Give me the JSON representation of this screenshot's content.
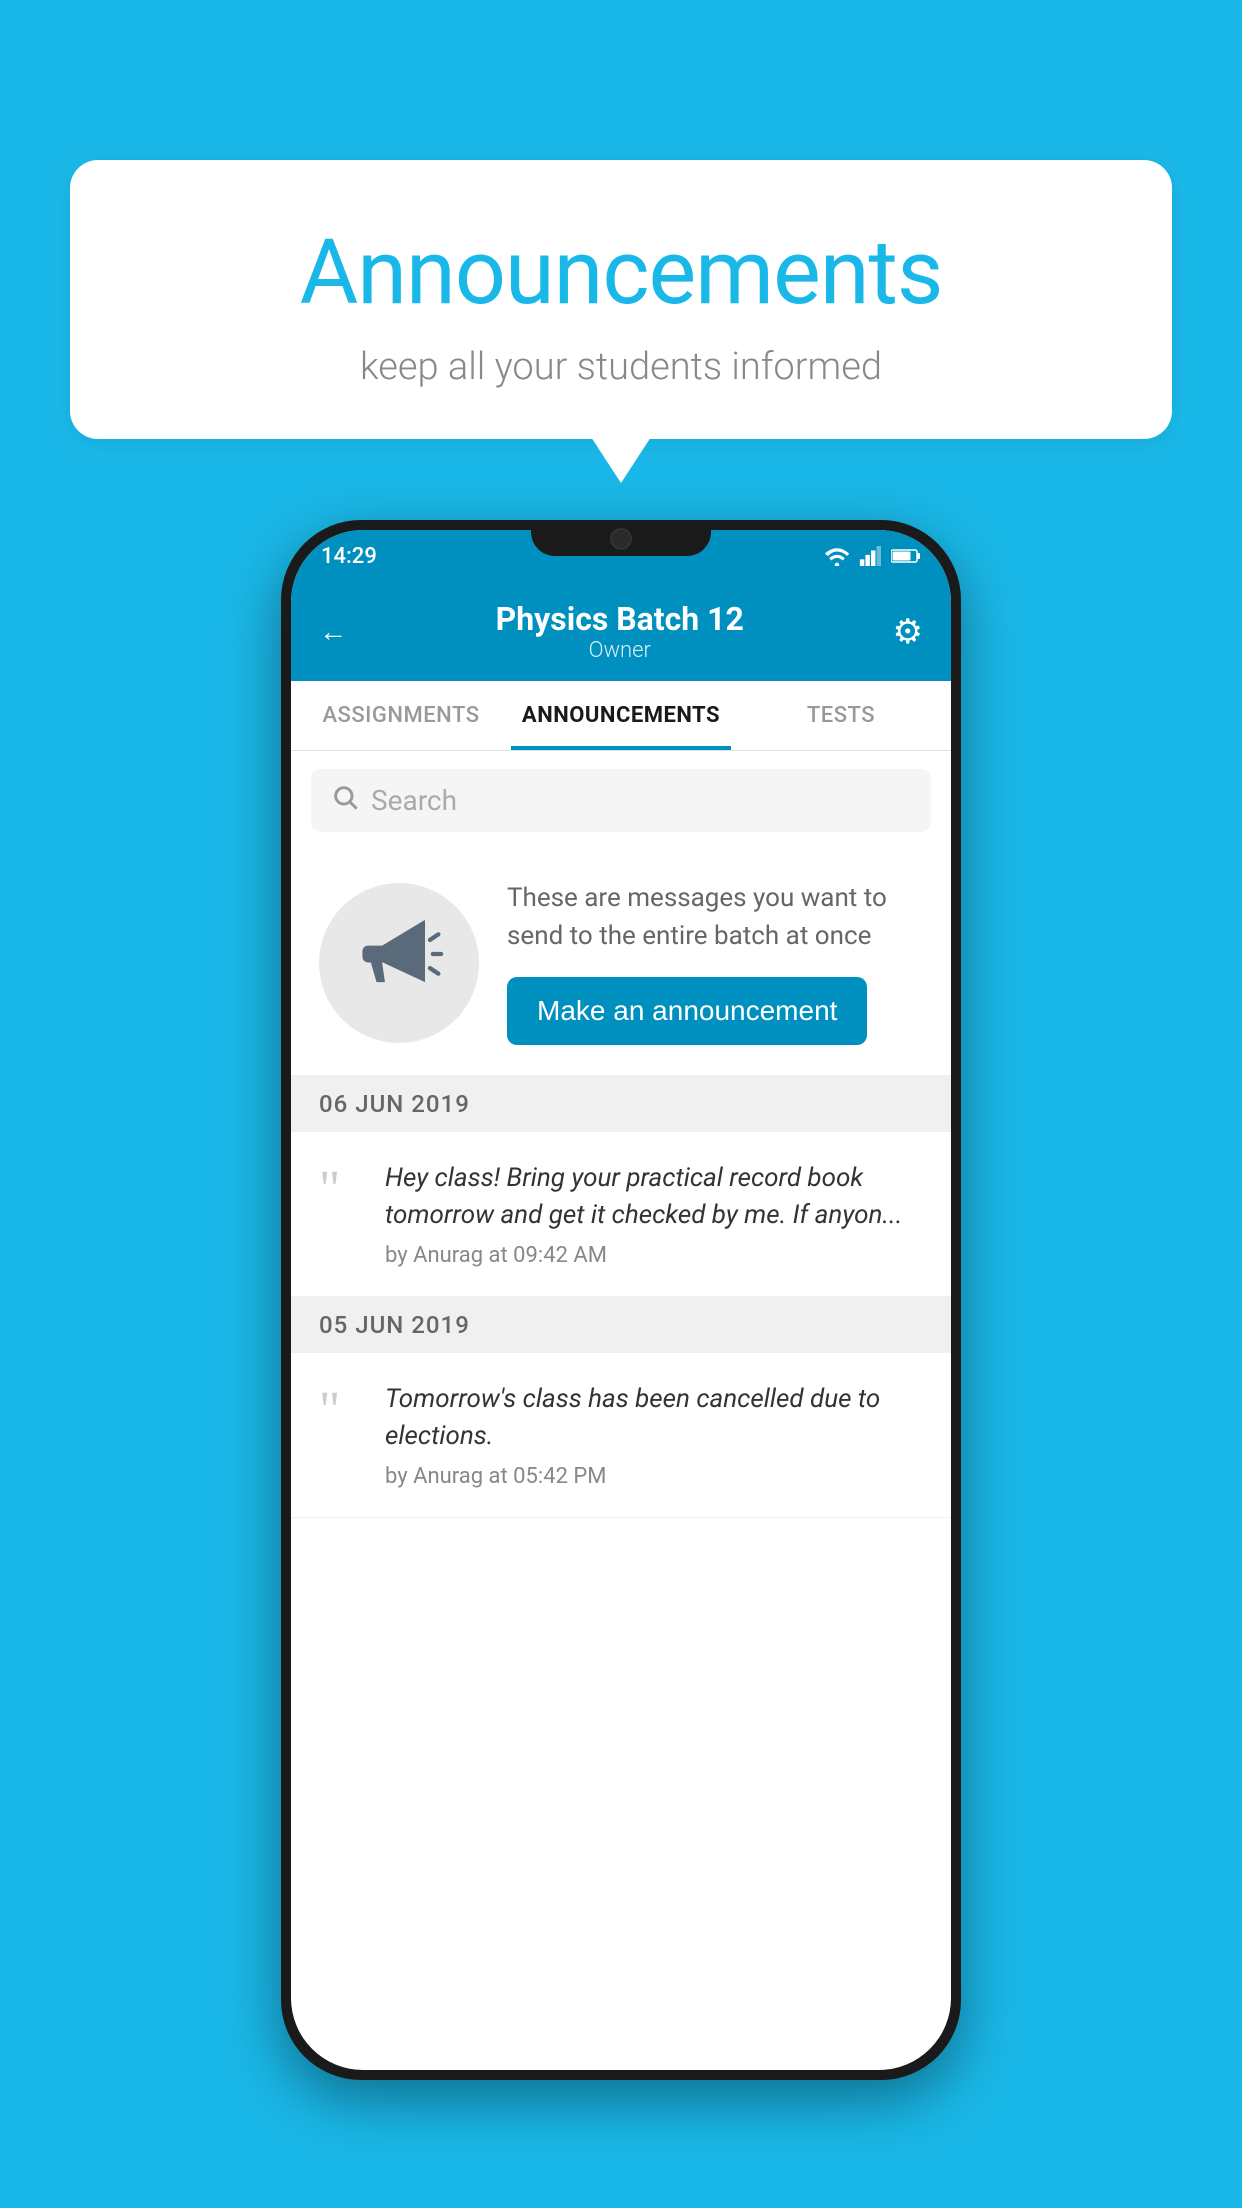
{
  "background_color": "#1ab8e8",
  "speech_bubble": {
    "title": "Announcements",
    "subtitle": "keep all your students informed"
  },
  "phone": {
    "status_bar": {
      "time": "14:29"
    },
    "header": {
      "title": "Physics Batch 12",
      "subtitle": "Owner",
      "back_label": "←",
      "gear_label": "⚙"
    },
    "tabs": [
      {
        "label": "ASSIGNMENTS",
        "active": false
      },
      {
        "label": "ANNOUNCEMENTS",
        "active": true
      },
      {
        "label": "TESTS",
        "active": false
      }
    ],
    "search": {
      "placeholder": "Search"
    },
    "promo": {
      "description": "These are messages you want to send to the entire batch at once",
      "button_label": "Make an announcement"
    },
    "announcements": [
      {
        "date": "06  JUN  2019",
        "items": [
          {
            "message": "Hey class! Bring your practical record book tomorrow and get it checked by me. If anyon...",
            "meta": "by Anurag at 09:42 AM"
          }
        ]
      },
      {
        "date": "05  JUN  2019",
        "items": [
          {
            "message": "Tomorrow's class has been cancelled due to elections.",
            "meta": "by Anurag at 05:42 PM"
          }
        ]
      }
    ]
  }
}
